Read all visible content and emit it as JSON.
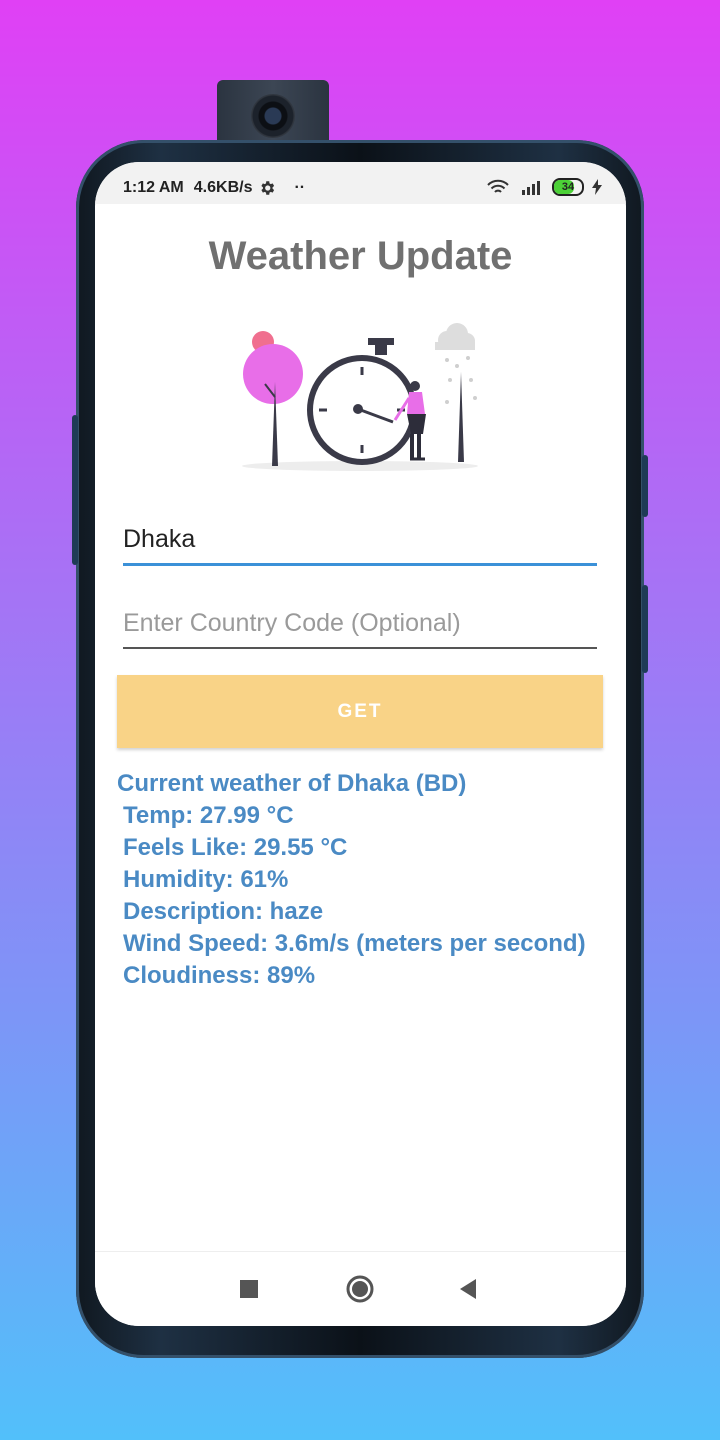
{
  "status_bar": {
    "time": "1:12 AM",
    "network_speed": "4.6KB/s",
    "battery": "34",
    "icons": [
      "settings-icon",
      "wifi-icon",
      "signal-icon",
      "battery-icon",
      "charging-icon"
    ]
  },
  "app": {
    "title": "Weather Update"
  },
  "form": {
    "city_value": "Dhaka",
    "country_placeholder": "Enter Country Code (Optional)",
    "get_label": "GET"
  },
  "result": {
    "heading": "Current weather of Dhaka (BD)",
    "temp": "Temp: 27.99 °C",
    "feels_like": "Feels Like: 29.55 °C",
    "humidity": "Humidity: 61%",
    "description": "Description: haze",
    "wind_speed": "Wind Speed: 3.6m/s (meters per second)",
    "cloudiness": "Cloudiness: 89%"
  },
  "nav": {
    "icons": [
      "recents-icon",
      "home-icon",
      "back-icon"
    ]
  },
  "colors": {
    "accent": "#3b91d8",
    "button": "#f9d387",
    "result_text": "#4a8ac4",
    "title": "#707070"
  }
}
